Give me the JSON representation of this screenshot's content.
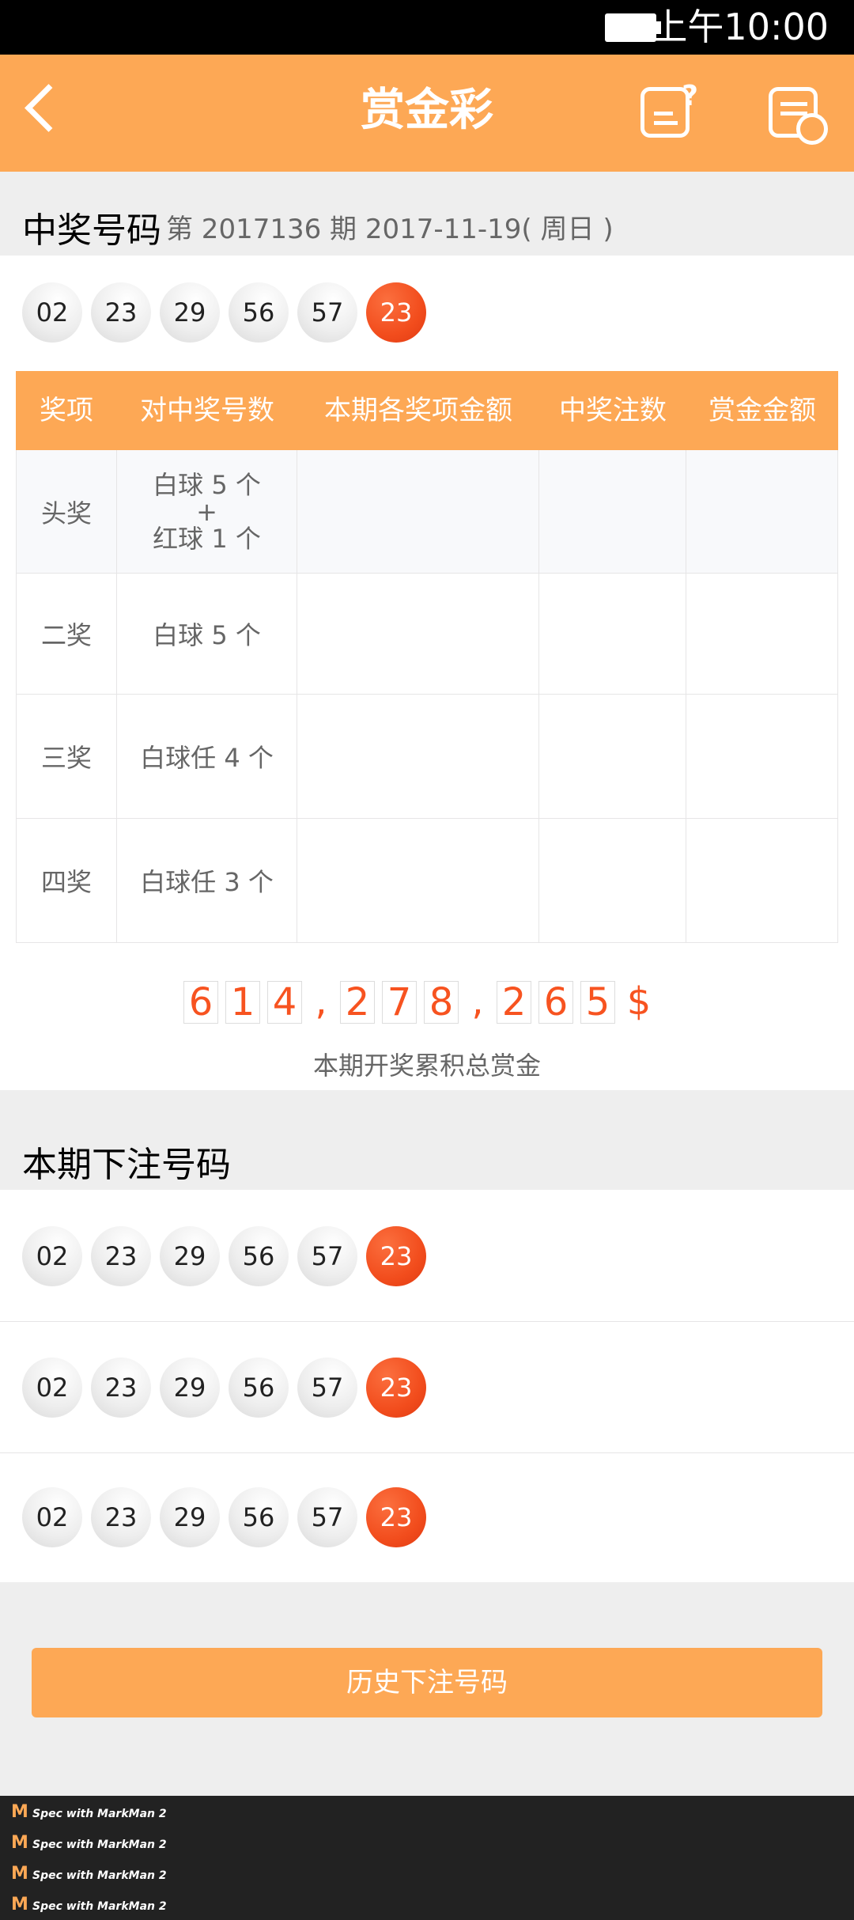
{
  "status": {
    "time": "上午10:00"
  },
  "header": {
    "title": "赏金彩"
  },
  "draw": {
    "section_title": "中奖号码",
    "info": "第 2017136 期  2017-11-19( 周日 )",
    "balls": [
      "02",
      "23",
      "29",
      "56",
      "57"
    ],
    "red_ball": "23"
  },
  "table": {
    "headers": [
      "奖项",
      "对中奖号数",
      "本期各奖项金额",
      "中奖注数",
      "赏金金额"
    ],
    "rows": [
      {
        "prize": "头奖",
        "match_line1": "白球 5 个",
        "match_line2": "+",
        "match_line3": "红球 1 个"
      },
      {
        "prize": "二奖",
        "match_line1": "白球 5 个"
      },
      {
        "prize": "三奖",
        "match_line1": "白球任 4 个"
      },
      {
        "prize": "四奖",
        "match_line1": "白球任 3 个"
      }
    ]
  },
  "jackpot": {
    "digits": [
      "6",
      "1",
      "4",
      "2",
      "7",
      "8",
      "2",
      "6",
      "5"
    ],
    "comma": ",",
    "currency": "$",
    "caption": "本期开奖累积总赏金"
  },
  "bets": {
    "section_title": "本期下注号码",
    "rows": [
      {
        "balls": [
          "02",
          "23",
          "29",
          "56",
          "57"
        ],
        "red": "23"
      },
      {
        "balls": [
          "02",
          "23",
          "29",
          "56",
          "57"
        ],
        "red": "23"
      },
      {
        "balls": [
          "02",
          "23",
          "29",
          "56",
          "57"
        ],
        "red": "23"
      }
    ]
  },
  "history_button": {
    "label": "历史下注号码"
  },
  "footer": {
    "lines": [
      "Spec with MarkMan 2",
      "Spec with MarkMan 2",
      "Spec with MarkMan 2",
      "Spec with MarkMan 2"
    ]
  },
  "colors": {
    "accent": "#fda855",
    "red_text": "#f75320",
    "text_gray": "#666666",
    "bg_gray": "#eeeeee",
    "divider": "#e6e5e6"
  }
}
